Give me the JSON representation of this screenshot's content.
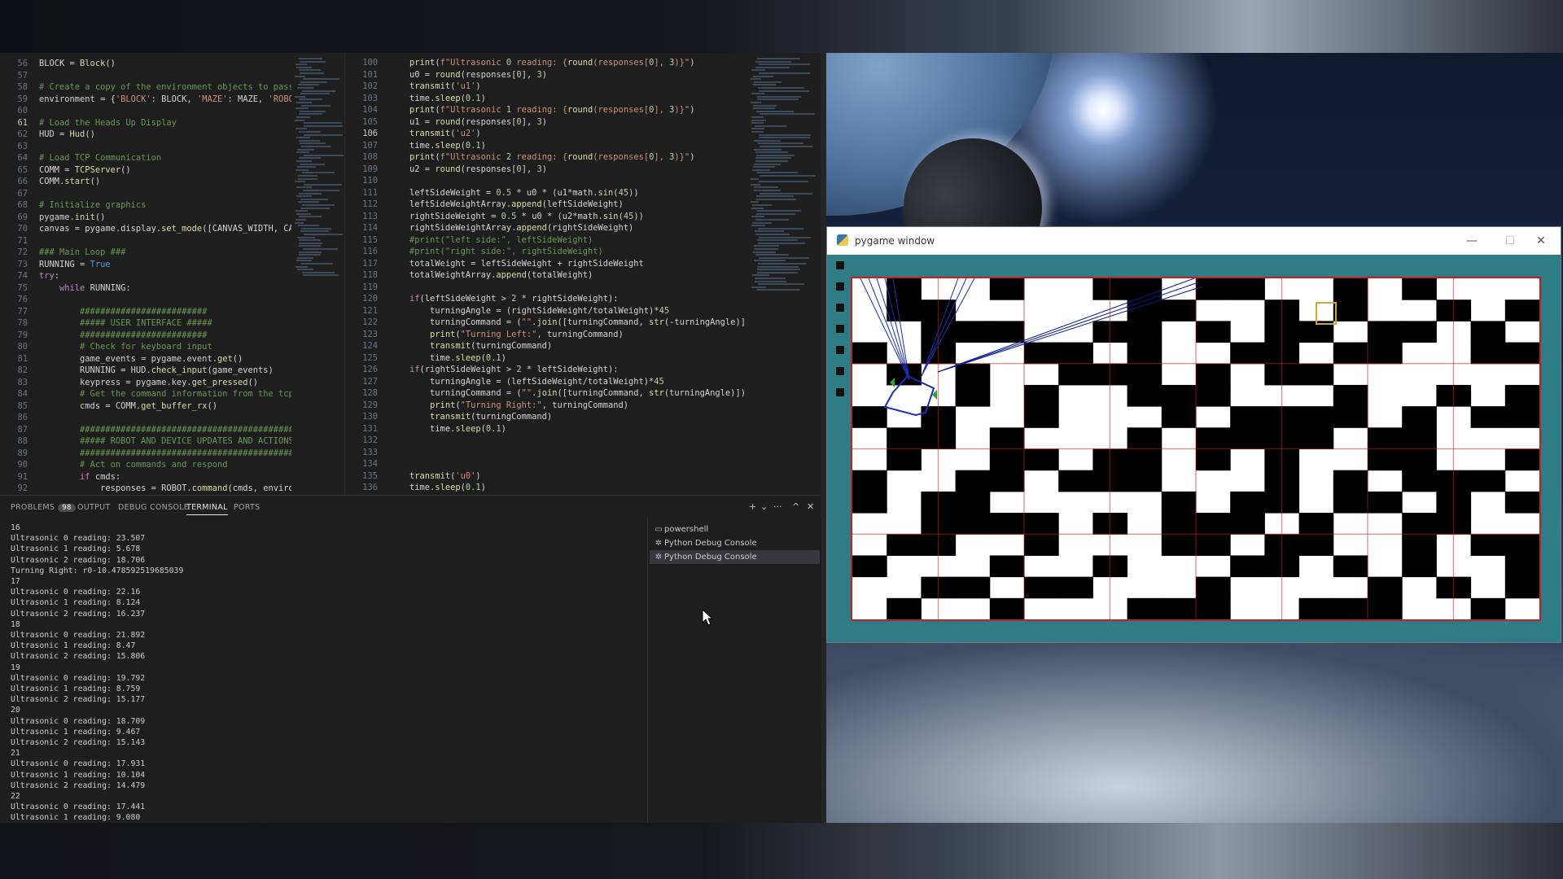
{
  "editor_left": {
    "lines": [
      {
        "n": "56",
        "text": "BLOCK = Block()"
      },
      {
        "n": "57",
        "text": ""
      },
      {
        "n": "58",
        "text": "# Create a copy of the environment objects to pass t"
      },
      {
        "n": "59",
        "text": "environment = {'BLOCK': BLOCK, 'MAZE': MAZE, 'ROBOT'"
      },
      {
        "n": "60",
        "text": ""
      },
      {
        "n": "61",
        "text": "# Load the Heads Up Display"
      },
      {
        "n": "62",
        "text": "HUD = Hud()"
      },
      {
        "n": "63",
        "text": ""
      },
      {
        "n": "64",
        "text": "# Load TCP Communication"
      },
      {
        "n": "65",
        "text": "COMM = TCPServer()"
      },
      {
        "n": "66",
        "text": "COMM.start()"
      },
      {
        "n": "67",
        "text": ""
      },
      {
        "n": "68",
        "text": "# Initialize graphics"
      },
      {
        "n": "69",
        "text": "pygame.init()"
      },
      {
        "n": "70",
        "text": "canvas = pygame.display.set_mode([CANVAS_WIDTH, CANV"
      },
      {
        "n": "71",
        "text": ""
      },
      {
        "n": "72",
        "text": "### Main Loop ###"
      },
      {
        "n": "73",
        "text": "RUNNING = True"
      },
      {
        "n": "74",
        "text": "try:"
      },
      {
        "n": "75",
        "text": "    while RUNNING:"
      },
      {
        "n": "76",
        "text": ""
      },
      {
        "n": "77",
        "text": "        #########################"
      },
      {
        "n": "78",
        "text": "        ##### USER INTERFACE #####"
      },
      {
        "n": "79",
        "text": "        #########################"
      },
      {
        "n": "80",
        "text": "        # Check for keyboard input"
      },
      {
        "n": "81",
        "text": "        game_events = pygame.event.get()"
      },
      {
        "n": "82",
        "text": "        RUNNING = HUD.check_input(game_events)"
      },
      {
        "n": "83",
        "text": "        keypress = pygame.key.get_pressed()"
      },
      {
        "n": "84",
        "text": "        # Get the command information from the tcp b"
      },
      {
        "n": "85",
        "text": "        cmds = COMM.get_buffer_rx()"
      },
      {
        "n": "86",
        "text": ""
      },
      {
        "n": "87",
        "text": "        ############################################"
      },
      {
        "n": "88",
        "text": "        ##### ROBOT AND DEVICE UPDATES AND ACTIONS #"
      },
      {
        "n": "89",
        "text": "        ############################################"
      },
      {
        "n": "90",
        "text": "        # Act on commands and respond"
      },
      {
        "n": "91",
        "text": "        if cmds:"
      },
      {
        "n": "92",
        "text": "            responses = ROBOT.command(cmds, environm"
      }
    ]
  },
  "editor_right": {
    "lines": [
      {
        "n": "100",
        "text": "    print(f\"Ultrasonic 0 reading: {round(responses[0], 3)}\")"
      },
      {
        "n": "101",
        "text": "    u0 = round(responses[0], 3)"
      },
      {
        "n": "102",
        "text": "    transmit('u1')"
      },
      {
        "n": "103",
        "text": "    time.sleep(0.1)"
      },
      {
        "n": "104",
        "text": "    print(f\"Ultrasonic 1 reading: {round(responses[0], 3)}\")"
      },
      {
        "n": "105",
        "text": "    u1 = round(responses[0], 3)"
      },
      {
        "n": "106",
        "text": "    transmit('u2')"
      },
      {
        "n": "107",
        "text": "    time.sleep(0.1)"
      },
      {
        "n": "108",
        "text": "    print(f\"Ultrasonic 2 reading: {round(responses[0], 3)}\")"
      },
      {
        "n": "109",
        "text": "    u2 = round(responses[0], 3)"
      },
      {
        "n": "110",
        "text": ""
      },
      {
        "n": "111",
        "text": "    leftSideWeight = 0.5 * u0 * (u1*math.sin(45))"
      },
      {
        "n": "112",
        "text": "    leftSideWeightArray.append(leftSideWeight)"
      },
      {
        "n": "113",
        "text": "    rightSideWeight = 0.5 * u0 * (u2*math.sin(45))"
      },
      {
        "n": "114",
        "text": "    rightSideWeightArray.append(rightSideWeight)"
      },
      {
        "n": "115",
        "text": "    #print(\"left side:\", leftSideWeight)"
      },
      {
        "n": "116",
        "text": "    #print(\"right side:\", rightSideWeight)"
      },
      {
        "n": "117",
        "text": "    totalWeight = leftSideWeight + rightSideWeight"
      },
      {
        "n": "118",
        "text": "    totalWeightArray.append(totalWeight)"
      },
      {
        "n": "119",
        "text": ""
      },
      {
        "n": "120",
        "text": "    if(leftSideWeight > 2 * rightSideWeight):"
      },
      {
        "n": "121",
        "text": "        turningAngle = (rightSideWeight/totalWeight)*45"
      },
      {
        "n": "122",
        "text": "        turningCommand = (\"\".join([turningCommand, str(-turningAngle)]))"
      },
      {
        "n": "123",
        "text": "        print(\"Turning Left:\", turningCommand)"
      },
      {
        "n": "124",
        "text": "        transmit(turningCommand)"
      },
      {
        "n": "125",
        "text": "        time.sleep(0.1)"
      },
      {
        "n": "126",
        "text": "    if(rightSideWeight > 2 * leftSideWeight):"
      },
      {
        "n": "127",
        "text": "        turningAngle = (leftSideWeight/totalWeight)*45"
      },
      {
        "n": "128",
        "text": "        turningCommand = (\"\".join([turningCommand, str(turningAngle)]))"
      },
      {
        "n": "129",
        "text": "        print(\"Turning Right:\", turningCommand)"
      },
      {
        "n": "130",
        "text": "        transmit(turningCommand)"
      },
      {
        "n": "131",
        "text": "        time.sleep(0.1)"
      },
      {
        "n": "132",
        "text": ""
      },
      {
        "n": "133",
        "text": ""
      },
      {
        "n": "134",
        "text": ""
      },
      {
        "n": "135",
        "text": "    transmit('u0')"
      },
      {
        "n": "136",
        "text": "    time.sleep(0.1)"
      }
    ]
  },
  "panel": {
    "tabs": [
      {
        "label": "PROBLEMS",
        "badge": "98"
      },
      {
        "label": "OUTPUT"
      },
      {
        "label": "DEBUG CONSOLE"
      },
      {
        "label": "TERMINAL",
        "active": true
      },
      {
        "label": "PORTS"
      }
    ],
    "actions": [
      "+",
      "⌄",
      "···",
      "^",
      "✕"
    ]
  },
  "terminal": {
    "lines": [
      "16",
      "Ultrasonic 0 reading: 23.507",
      "Ultrasonic 1 reading: 5.678",
      "Ultrasonic 2 reading: 18.706",
      "Turning Right: r0-10.478592519685039",
      "17",
      "Ultrasonic 0 reading: 22.16",
      "Ultrasonic 1 reading: 8.124",
      "Ultrasonic 2 reading: 16.237",
      "18",
      "Ultrasonic 0 reading: 21.892",
      "Ultrasonic 1 reading: 8.47",
      "Ultrasonic 2 reading: 15.806",
      "19",
      "Ultrasonic 0 reading: 19.792",
      "Ultrasonic 1 reading: 8.759",
      "Ultrasonic 2 reading: 15.177",
      "20",
      "Ultrasonic 0 reading: 18.709",
      "Ultrasonic 1 reading: 9.467",
      "Ultrasonic 2 reading: 15.143",
      "21",
      "Ultrasonic 0 reading: 17.931",
      "Ultrasonic 1 reading: 10.104",
      "Ultrasonic 2 reading: 14.479",
      "22",
      "Ultrasonic 0 reading: 17.441",
      "Ultrasonic 1 reading: 9.080"
    ],
    "sessions": [
      {
        "label": "powershell",
        "icon": "terminal-icon"
      },
      {
        "label": "Python Debug Console",
        "icon": "debug-icon"
      },
      {
        "label": "Python Debug Console",
        "icon": "debug-icon",
        "selected": true
      }
    ]
  },
  "pygame": {
    "title": "pygame window",
    "controls": [
      "—",
      "☐",
      "✕"
    ],
    "maze_grid": [
      "01001001101100101000",
      "01100000110010100101",
      "00111001101011011010",
      "10100110100110110011",
      "01010011101011000000",
      "00010100111000100101",
      "10100100010111101011",
      "01101000101111011000",
      "01001101101010011001",
      "10011011100010101110",
      "10110000010110110101",
      "00111101011101001100",
      "01100100011011001011",
      "10001001000110101001",
      "00110110001000010101",
      "01001000111001110010"
    ],
    "colors": {
      "wall": "#000000",
      "open": "#ffffff",
      "frame": "#c42020",
      "robot": "#1a2fb0",
      "sensor": "#2f9e3a",
      "background": "#2e7d86"
    }
  }
}
